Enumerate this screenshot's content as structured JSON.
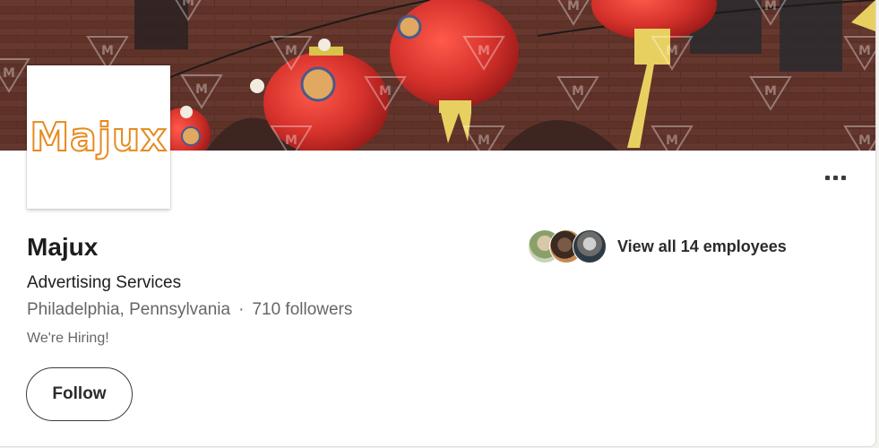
{
  "company": {
    "name": "Majux",
    "logo_text": "Majux",
    "industry": "Advertising Services",
    "location": "Philadelphia, Pennsylvania",
    "separator": "·",
    "followers": "710 followers",
    "tagline": "We're Hiring!"
  },
  "actions": {
    "follow_label": "Follow",
    "more_icon": "more-horizontal-icon"
  },
  "employees": {
    "label": "View all 14 employees",
    "avatar_count": 3
  },
  "banner": {
    "description_icon": "red-lanterns-banner-image",
    "watermark_letter": "M"
  },
  "colors": {
    "logo_accent": "#e68a1e",
    "text_primary": "#1d1d1d",
    "text_secondary": "#666666",
    "lantern_red": "#d6322c"
  }
}
